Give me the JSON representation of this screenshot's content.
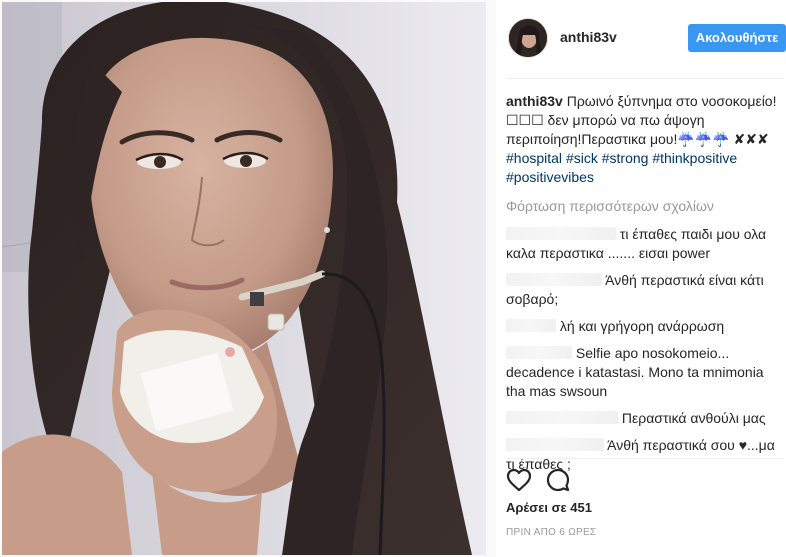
{
  "post": {
    "username": "anthi83v",
    "follow_label": "Ακολουθήστε",
    "caption_text": "Πρωινό ξύπνημα στο νοσοκομείο!☐☐☐ δεν μπορώ να πω άψογη περιποίηση!Περαστικα μου!☔☔☔ ✘✘✘",
    "hashtags": [
      "#hospital",
      "#sick",
      "#strong",
      "#thinkpositive",
      "#positivevibes"
    ],
    "load_more_label": "Φόρτωση περισσότερων σχολίων",
    "likes_text": "Αρέσει σε 451",
    "time_text": "ΠΡΙΝ ΑΠΟ 6 ΩΡΕΣ"
  },
  "comments": [
    {
      "text": "τι έπαθες παιδι μου ολα καλα περαστικα ....... εισαι power"
    },
    {
      "text": "Άνθή περαστικά είναι κάτι σοβαρό;"
    },
    {
      "text": "λή και γρήγορη ανάρρωση"
    },
    {
      "text": "Selfie apo nosokomeio... decadence i katastasi. Mono ta mnimonia tha mas swsoun"
    },
    {
      "text": "Περαστικά ανθούλι μας"
    },
    {
      "text": "Άνθή περαστικά σου ♥...μα τι έπαθες ;"
    }
  ],
  "icons": {
    "like": "heart-outline-icon",
    "comment": "comment-bubble-icon"
  },
  "colors": {
    "follow_button": "#3897f0",
    "hashtag": "#003569",
    "muted": "#999999"
  }
}
